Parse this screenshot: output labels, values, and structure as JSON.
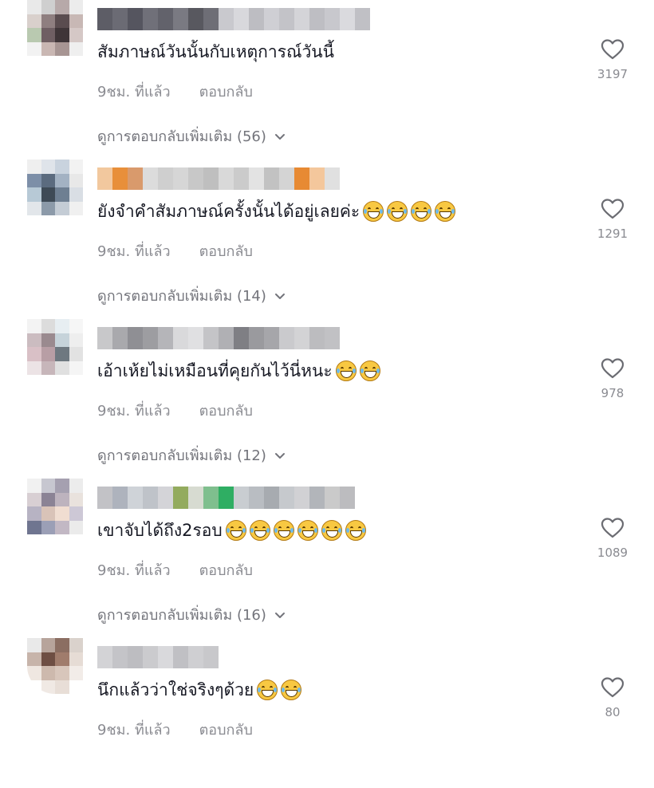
{
  "comments": [
    {
      "text": "สัมภาษณ์วันนั้นกับเหตุการณ์วันนี้",
      "emoji_count": 0,
      "time": "9ชม. ที่แล้ว",
      "reply_label": "ตอบกลับ",
      "view_more": "ดูการตอบกลับเพิ่มเติม (56)",
      "likes": "3197",
      "avatar_colors": [
        "#e9e9e9",
        "#cfcfcf",
        "#b7a9a9",
        "#ececec",
        "#d9d0cc",
        "#8f7f80",
        "#5a4c4f",
        "#c8b8b5",
        "#b9c9b0",
        "#6f5f63",
        "#3f3538",
        "#d5c8c6",
        "#f2f2f2",
        "#c9b7b3",
        "#a79593",
        "#efefef"
      ],
      "username_colors": [
        "#5d5d66",
        "#6b6b74",
        "#55555f",
        "#707079",
        "#62626b",
        "#7a7a82",
        "#58585f",
        "#6e6e76",
        "#c9c9ce",
        "#d8d8dc",
        "#bdbdc2",
        "#cfcfd4",
        "#c3c3c8",
        "#d4d4d8",
        "#bebec3",
        "#c8c8cd",
        "#dadade",
        "#c0c0c5"
      ]
    },
    {
      "text": "ยังจำคำสัมภาษณ์ครั้งนั้นได้อยู่เลยค่ะ ",
      "emoji_count": 4,
      "time": "9ชม. ที่แล้ว",
      "reply_label": "ตอบกลับ",
      "view_more": "ดูการตอบกลับเพิ่มเติม (14)",
      "likes": "1291",
      "avatar_colors": [
        "#efefef",
        "#dfe4ea",
        "#c9d3de",
        "#f2f2f2",
        "#7d8fa8",
        "#5b6b7f",
        "#a3b2c3",
        "#e8e8e8",
        "#b7c9d6",
        "#3e4a56",
        "#6e7f92",
        "#d9dee4",
        "#e2e6ea",
        "#8c9aa9",
        "#c4ccd5",
        "#f0f0f0"
      ],
      "username_colors": [
        "#f2c89e",
        "#e88f3a",
        "#d99a6c",
        "#dcdcdc",
        "#cfcfcf",
        "#d6d6d6",
        "#c8c8c8",
        "#bfbfbf",
        "#d9d9d9",
        "#cbcbcb",
        "#e3e3e3",
        "#c2c2c2",
        "#d4d4d4",
        "#e78a33",
        "#f4c79c",
        "#e0e0e0"
      ]
    },
    {
      "text": "เอ้าเห้ยไม่เหมือนที่คุยกันไว้นี่หนะ",
      "emoji_count": 2,
      "time": "9ชม. ที่แล้ว",
      "reply_label": "ตอบกลับ",
      "view_more": "ดูการตอบกลับเพิ่มเติม (12)",
      "likes": "978",
      "avatar_colors": [
        "#f3f3f3",
        "#dcdcdc",
        "#e7eef2",
        "#f6f6f6",
        "#cbbcc0",
        "#9a8a8f",
        "#c6d3da",
        "#eeeeee",
        "#d9c0c6",
        "#b89ea5",
        "#6e7880",
        "#e2e2e2",
        "#ece3e5",
        "#c7b6ba",
        "#e0e0e0",
        "#f5f5f5"
      ],
      "username_colors": [
        "#c8c8ca",
        "#a9a9ad",
        "#8f8f94",
        "#9d9da1",
        "#b5b5b9",
        "#d9d9db",
        "#e0e0e2",
        "#c4c4c7",
        "#b0b0b4",
        "#7f7f84",
        "#9a9a9e",
        "#a6a6aa",
        "#cacacd",
        "#d3d3d5",
        "#bcbcbf",
        "#c1c1c4"
      ]
    },
    {
      "text": "เขาจับได้ถึง2รอบ",
      "emoji_count": 6,
      "time": "9ชม. ที่แล้ว",
      "reply_label": "ตอบกลับ",
      "view_more": "ดูการตอบกลับเพิ่มเติม (16)",
      "likes": "1089",
      "avatar_colors": [
        "#f1f1f1",
        "#c7c7d0",
        "#a5a0b0",
        "#ececec",
        "#d8cfd3",
        "#8b8395",
        "#bdb3be",
        "#e9e2dd",
        "#b7b3c3",
        "#d9c3b8",
        "#f0ddd1",
        "#cdc8d6",
        "#6f7590",
        "#9b9fb6",
        "#c2b8c4",
        "#ebebeb"
      ],
      "username_colors": [
        "#c2c2c6",
        "#aeb3bd",
        "#cfd3d8",
        "#bfc3c9",
        "#d4d4d8",
        "#93ab5e",
        "#d7dbd1",
        "#7fbf8e",
        "#2fae63",
        "#c9cdd1",
        "#b9bdc2",
        "#a7abb0",
        "#c6c9cd",
        "#d1d1d4",
        "#b2b5ba",
        "#cacaca",
        "#bcbcbf"
      ]
    },
    {
      "text": "นึกแล้วว่าใช่จริงๆด้วย",
      "emoji_count": 2,
      "time": "9ชม. ที่แล้ว",
      "reply_label": "ตอบกลับ",
      "view_more": "",
      "likes": "80",
      "avatar_colors": [
        "#e9e9e9",
        "#b7a49b",
        "#8b6e62",
        "#dad2cc",
        "#c7b4aa",
        "#6e4e43",
        "#a07c6c",
        "#e6dcd5",
        "#efe7e1",
        "#cdb9ad",
        "#d8c6bb",
        "#f2ece8",
        "#ffffff",
        "#f0e9e4",
        "#e8ded7",
        "#ffffff"
      ],
      "username_colors": [
        "#d3d3d6",
        "#c4c4c8",
        "#bdbdc1",
        "#cbcbce",
        "#d9d9dc",
        "#c0c0c4",
        "#cfcfd2",
        "#c8c8cb"
      ]
    }
  ]
}
